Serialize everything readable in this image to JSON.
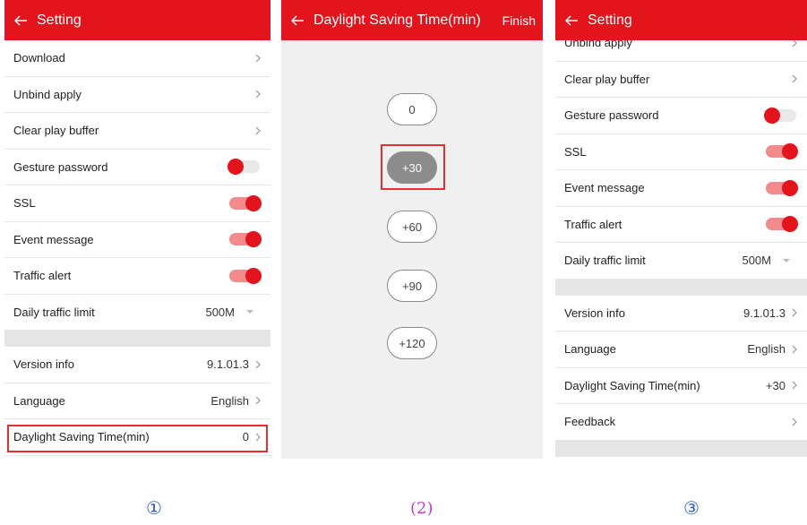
{
  "colors": {
    "header_red": "#e3141c",
    "toggle_on_track": "#f38a8c",
    "highlight": "#e03030"
  },
  "panel1": {
    "title": "Setting",
    "items": [
      {
        "label": "Download"
      },
      {
        "label": "Unbind apply"
      },
      {
        "label": "Clear play buffer"
      },
      {
        "label": "Gesture password",
        "toggle": "off"
      },
      {
        "label": "SSL",
        "toggle": "on"
      },
      {
        "label": "Event message",
        "toggle": "on"
      },
      {
        "label": "Traffic alert",
        "toggle": "on"
      },
      {
        "label": "Daily traffic limit",
        "value": "500M"
      },
      {
        "label": "Version info",
        "value": "9.1.01.3"
      },
      {
        "label": "Language",
        "value": "English"
      },
      {
        "label": "Daylight Saving Time(min)",
        "value": "0"
      }
    ]
  },
  "panel2": {
    "title": "Daylight Saving Time(min)",
    "finish": "Finish",
    "options": [
      "0",
      "+30",
      "+60",
      "+90",
      "+120"
    ],
    "selected": "+30"
  },
  "panel3": {
    "title": "Setting",
    "items": [
      {
        "label": "Unbind apply"
      },
      {
        "label": "Clear play buffer"
      },
      {
        "label": "Gesture password",
        "toggle": "off"
      },
      {
        "label": "SSL",
        "toggle": "on"
      },
      {
        "label": "Event message",
        "toggle": "on"
      },
      {
        "label": "Traffic alert",
        "toggle": "on"
      },
      {
        "label": "Daily traffic limit",
        "value": "500M"
      },
      {
        "label": "Version info",
        "value": "9.1.01.3"
      },
      {
        "label": "Language",
        "value": "English"
      },
      {
        "label": "Daylight Saving Time(min)",
        "value": "+30"
      },
      {
        "label": "Feedback"
      }
    ]
  },
  "markers": [
    "①",
    "(2)",
    "③"
  ]
}
